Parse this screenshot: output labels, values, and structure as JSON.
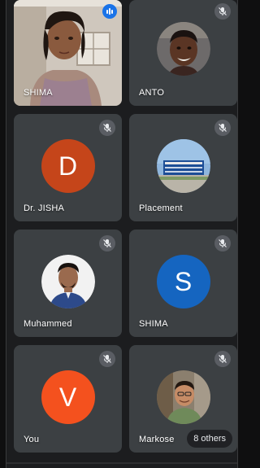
{
  "participants": [
    {
      "name": "SHIMA",
      "type": "video"
    },
    {
      "name": "ANTO",
      "type": "photo"
    },
    {
      "name": "Dr. JISHA",
      "type": "initial",
      "initial": "D",
      "color": "#c5451a"
    },
    {
      "name": "Placement",
      "type": "photo"
    },
    {
      "name": "Muhammed",
      "type": "photo"
    },
    {
      "name": "SHIMA",
      "type": "initial",
      "initial": "S",
      "color": "#1565c0"
    },
    {
      "name": "You",
      "type": "initial",
      "initial": "V",
      "color": "#f4511e"
    },
    {
      "name": "Markose",
      "type": "photo"
    }
  ],
  "others_label": "8 others",
  "icons": {
    "muted": "mic-off-icon",
    "speaking": "audio-level-icon"
  },
  "colors": {
    "tile_bg": "#3c4043",
    "page_bg": "#1c1d1f",
    "mute_bg": "#5f6368",
    "speaking": "#1a73e8"
  }
}
